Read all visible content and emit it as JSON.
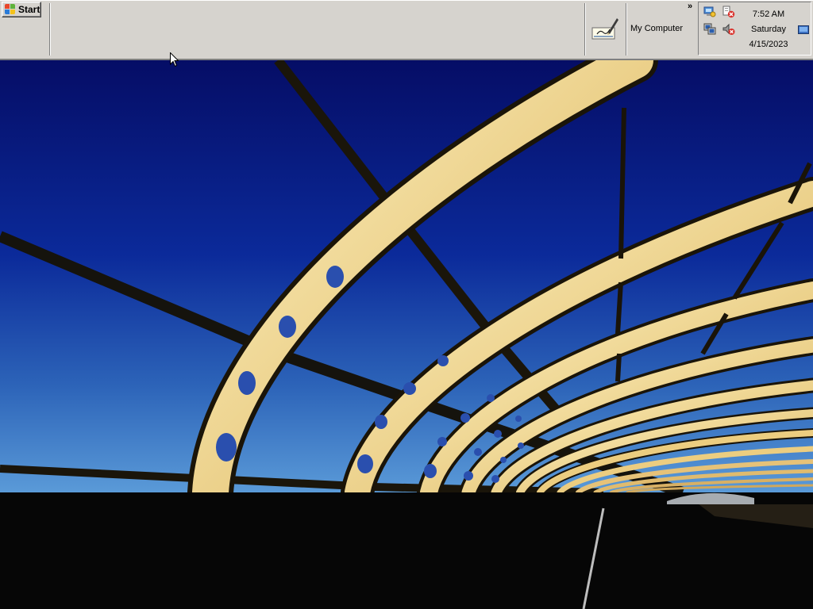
{
  "taskbar": {
    "start_label": "Start",
    "quicklaunch_label": "My Computer",
    "overflow_label": "»"
  },
  "tray": {
    "time": "7:52 AM",
    "day": "Saturday",
    "date": "4/15/2023",
    "icons": [
      "network-icon",
      "network-disconnected-icon",
      "computer-icon",
      "volume-muted-icon",
      "show-desktop-icon"
    ]
  },
  "desktop": {
    "wallpaper": "bridge-at-dusk"
  },
  "colors": {
    "taskbar": "#d6d3ce",
    "sky_top": "#06127a",
    "sky_bottom": "#3a78c8",
    "arch": "#f0d488"
  }
}
